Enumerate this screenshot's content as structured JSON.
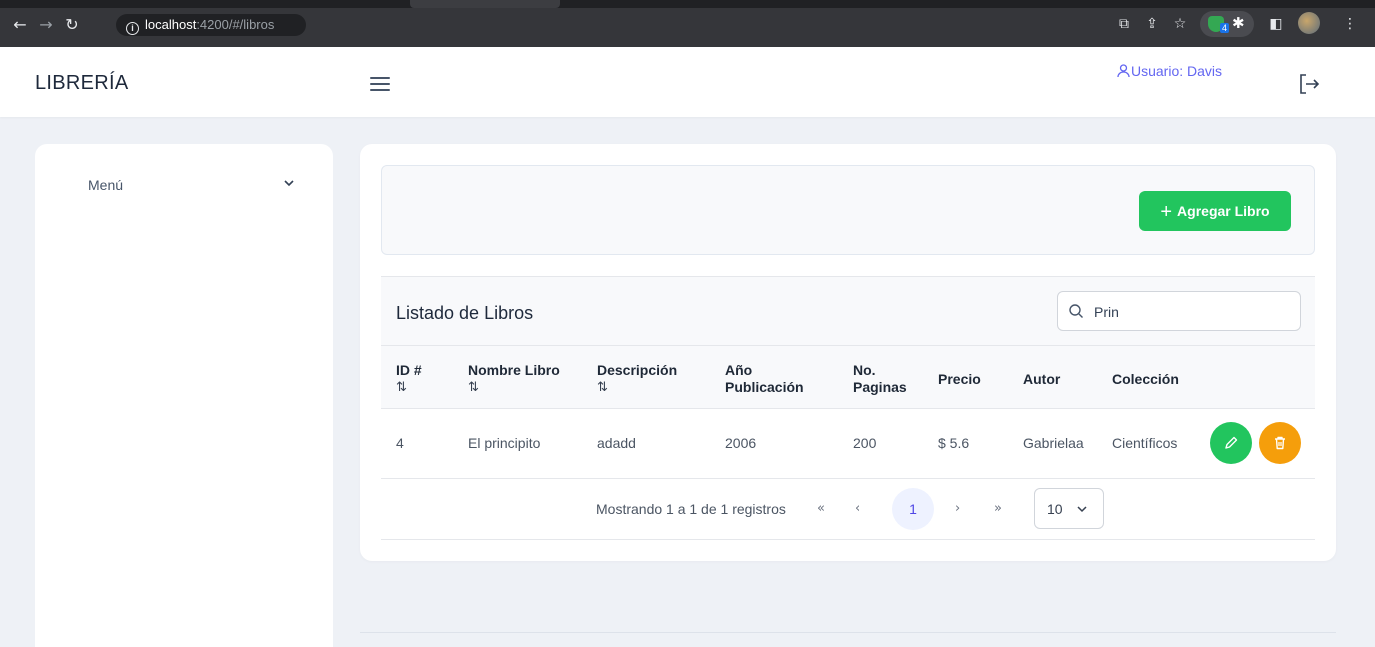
{
  "browser": {
    "url_host": "localhost",
    "url_path": ":4200/#/libros",
    "extension_badge": "4"
  },
  "header": {
    "brand": "LIBRERÍA",
    "user_label": "Usuario: Davis"
  },
  "sidebar": {
    "menu_label": "Menú"
  },
  "toolbar": {
    "add_label": "Agregar Libro"
  },
  "table": {
    "title": "Listado de Libros",
    "search_value": "Prin",
    "columns": [
      {
        "label": "ID #",
        "sortable": true
      },
      {
        "label": "Nombre Libro",
        "sortable": true
      },
      {
        "label": "Descripción",
        "sortable": true
      },
      {
        "label": "Año Publicación",
        "sortable": false
      },
      {
        "label": "No. Paginas",
        "sortable": false
      },
      {
        "label": "Precio",
        "sortable": false
      },
      {
        "label": "Autor",
        "sortable": false
      },
      {
        "label": "Colección",
        "sortable": false
      }
    ],
    "sort_glyph": "⇅",
    "rows": [
      {
        "id": "4",
        "nombre": "El principito",
        "descripcion": "adadd",
        "anio": "2006",
        "paginas": "200",
        "precio": "$ 5.6",
        "autor": "Gabrielaa",
        "coleccion": "Científicos"
      }
    ]
  },
  "pagination": {
    "info": "Mostrando 1 a 1 de 1 registros",
    "first": "«",
    "prev": "‹",
    "current_page": "1",
    "next": "›",
    "last": "»",
    "rows_per_page": "10"
  },
  "colors": {
    "accent": "#6366f1",
    "success": "#22c55e",
    "warning": "#f59e0b",
    "background": "#eef1f6"
  }
}
